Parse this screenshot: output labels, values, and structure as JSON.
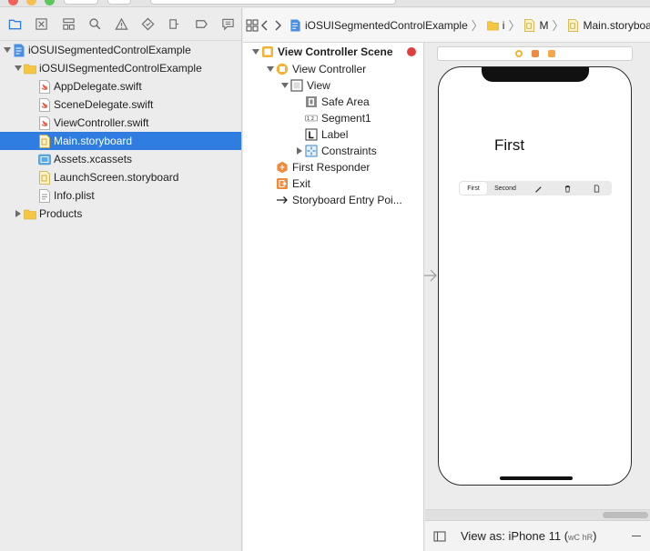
{
  "navigator": {
    "items": [
      {
        "label": "iOSUISegmentedControlExample",
        "icon": "xcode-project-icon"
      },
      {
        "label": "iOSUISegmentedControlExample",
        "icon": "folder-icon"
      },
      {
        "label": "AppDelegate.swift",
        "icon": "swift-file-icon"
      },
      {
        "label": "SceneDelegate.swift",
        "icon": "swift-file-icon"
      },
      {
        "label": "ViewController.swift",
        "icon": "swift-file-icon"
      },
      {
        "label": "Main.storyboard",
        "icon": "storyboard-file-icon"
      },
      {
        "label": "Assets.xcassets",
        "icon": "asset-catalog-icon"
      },
      {
        "label": "LaunchScreen.storyboard",
        "icon": "storyboard-file-icon"
      },
      {
        "label": "Info.plist",
        "icon": "plist-file-icon"
      },
      {
        "label": "Products",
        "icon": "folder-icon"
      }
    ],
    "selected_index": 5
  },
  "breadcrumb": {
    "project": "iOSUISegmentedControlExample",
    "group": "i",
    "file_short": "M",
    "file": "Main.storyboard"
  },
  "outline": {
    "scene": "View Controller Scene",
    "view_controller": "View Controller",
    "view": "View",
    "safe_area": "Safe Area",
    "segment": "Segment1",
    "label": "Label",
    "constraints": "Constraints",
    "first_responder": "First Responder",
    "exit": "Exit",
    "entry_point": "Storyboard Entry Poi..."
  },
  "canvas": {
    "label_text": "First",
    "segments": [
      "First",
      "Second"
    ],
    "view_as": "View as: iPhone 11 (",
    "view_as_w": "wC",
    "view_as_h": "hR",
    "view_as_end": ")"
  },
  "colors": {
    "selection": "#2f7de1",
    "folder": "#f5c642",
    "swift": "#e8563f",
    "scene": "#f5b335",
    "error": "#e23d3d"
  }
}
